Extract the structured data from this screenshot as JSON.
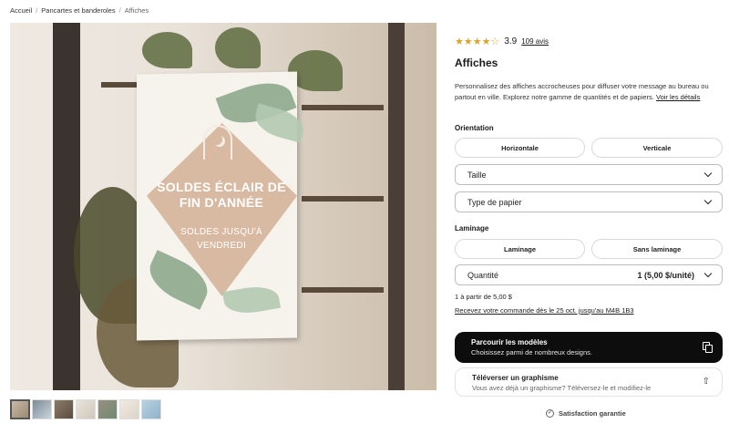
{
  "breadcrumb": {
    "home": "Accueil",
    "category": "Pancartes et banderoles",
    "current": "Affiches"
  },
  "poster": {
    "headline_line1": "SOLDES ÉCLAIR DE",
    "headline_line2": "FIN D'ANNÉE",
    "sub_line1": "SOLDES JUSQU'À",
    "sub_line2": "VENDREDI"
  },
  "product": {
    "rating_stars": "★★★★☆",
    "rating_value": "3.9",
    "reviews": "109 avis",
    "title": "Affiches",
    "description": "Personnalisez des affiches accrocheuses pour diffuser votre message au bureau ou partout en ville. Explorez notre gamme de quantités et de papiers.",
    "details_link": "Voir les détails"
  },
  "options": {
    "orientation_label": "Orientation",
    "orientation_horizontal": "Horizontale",
    "orientation_vertical": "Verticale",
    "size_label": "Taille",
    "paper_label": "Type de papier",
    "lamination_label": "Laminage",
    "lamination_on": "Laminage",
    "lamination_off": "Sans laminage",
    "quantity_label": "Quantité",
    "quantity_value": "1 (5,00 $/unité)"
  },
  "pricing": {
    "from_price": "1 à partir de 5,00 $",
    "delivery": "Recevez votre commande dès le 25 oct. jusqu'au M4B 1B3"
  },
  "actions": {
    "browse_title": "Parcourir les modèles",
    "browse_sub": "Choisissez parmi de nombreux designs.",
    "upload_title": "Téléverser un graphisme",
    "upload_sub": "Vous avez déjà un graphisme? Téléversez-le et modifiez-le"
  },
  "guarantee": "Satisfaction garantie",
  "colors": {
    "thumbs": [
      "#c7b9a4",
      "#7d8c9a",
      "#8a7a68",
      "#e8e4dc",
      "#9a8e7e",
      "#efeae2",
      "#b9d2e2"
    ]
  }
}
